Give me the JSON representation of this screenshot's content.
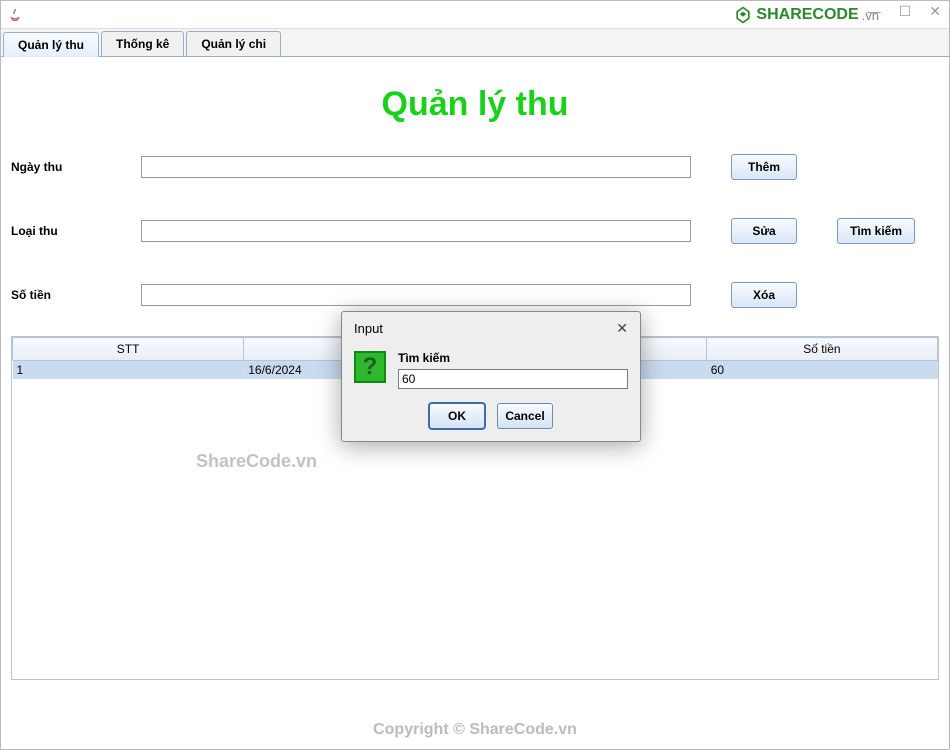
{
  "titlebar": {
    "title": ""
  },
  "brand": {
    "text": "SHARECODE",
    "suffix": ".vn"
  },
  "tabs": [
    {
      "label": "Quản lý thu",
      "active": true
    },
    {
      "label": "Thống kê",
      "active": false
    },
    {
      "label": "Quản lý chi",
      "active": false
    }
  ],
  "heading": "Quản lý thu",
  "form": {
    "ngay_thu": {
      "label": "Ngày thu",
      "value": ""
    },
    "loai_thu": {
      "label": "Loại thu",
      "value": ""
    },
    "so_tien": {
      "label": "Số tiền",
      "value": ""
    }
  },
  "buttons": {
    "them": "Thêm",
    "sua": "Sửa",
    "tim_kiem": "Tìm kiếm",
    "xoa": "Xóa"
  },
  "table": {
    "headers": [
      "STT",
      "",
      "",
      "Số tiền"
    ],
    "rows": [
      {
        "stt": "1",
        "ngay": "16/6/2024",
        "loai": "",
        "tien": "60"
      }
    ]
  },
  "dialog": {
    "title": "Input",
    "label": "Tìm kiếm",
    "value": "60",
    "ok": "OK",
    "cancel": "Cancel"
  },
  "watermark": "ShareCode.vn",
  "footer": "Copyright © ShareCode.vn"
}
